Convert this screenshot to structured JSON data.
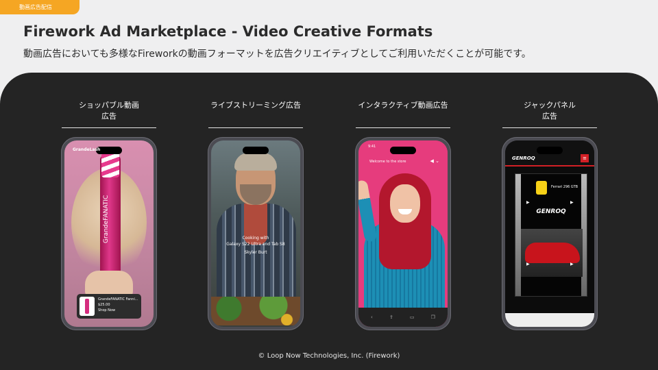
{
  "header": {
    "tag": "動画広告配信",
    "title": "Firework Ad Marketplace - Video Creative Formats",
    "subtitle": "動画広告においても多様なFireworkの動画フォーマットを広告クリエイティブとしてご利用いただくことが可能です。"
  },
  "formats": [
    {
      "label_line1": "ショッパブル動画",
      "label_line2": "広告"
    },
    {
      "label_line1": "ライブストリーミング広告",
      "label_line2": ""
    },
    {
      "label_line1": "インタラクティブ動画広告",
      "label_line2": ""
    },
    {
      "label_line1": "ジャックパネル",
      "label_line2": "広告"
    }
  ],
  "phone1": {
    "store": "GrandeLash",
    "brand": "GrandeFANATIC",
    "product_name": "GrandeFANATIC Fanni...",
    "price": "$25.00",
    "cta": "Shop Now"
  },
  "phone2": {
    "caption_line1": "Cooking with",
    "caption_line2": "Galaxy S22 Ultra and Tab S8",
    "host": "Skyler Burt"
  },
  "phone3": {
    "time": "9:41",
    "welcome": "Welcome to the store"
  },
  "phone4": {
    "logo": "GENROQ",
    "ad_title": "Ferrari 296 GTB",
    "ad_logo": "GENROQ"
  },
  "footer": {
    "copyright": "© Loop Now Technologies, Inc. (Firework)"
  },
  "colors": {
    "accent": "#f5a623",
    "panel": "#242424",
    "background": "#efeff0"
  }
}
